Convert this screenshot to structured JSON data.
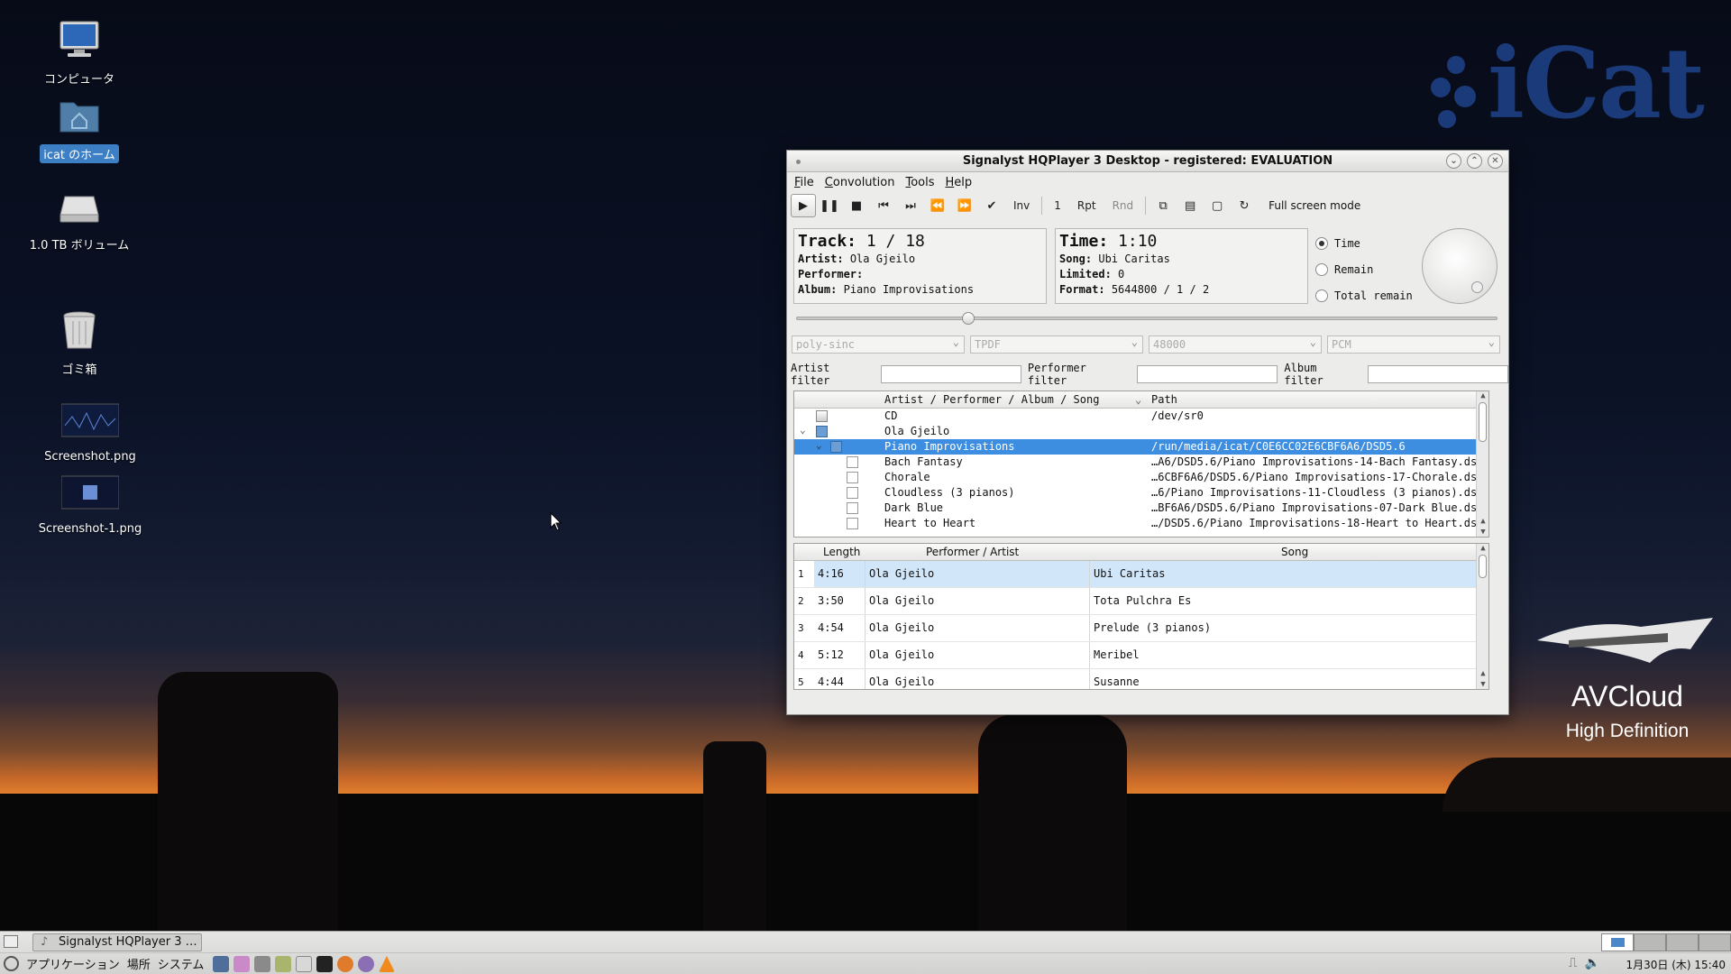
{
  "desktop": {
    "icons": [
      {
        "label": "コンピュータ",
        "icon": "computer-icon"
      },
      {
        "label": "icat のホーム",
        "icon": "home-folder-icon"
      },
      {
        "label": "1.0 TB ボリューム",
        "icon": "drive-icon"
      },
      {
        "label": "ゴミ箱",
        "icon": "trash-icon"
      },
      {
        "label": "Screenshot.png",
        "icon": "image-file-icon"
      },
      {
        "label": "Screenshot-1.png",
        "icon": "image-file-icon"
      }
    ],
    "wallpaper_logo": "iCat",
    "watermark_title": "AVCloud",
    "watermark_subtitle": "High Definition"
  },
  "window": {
    "title": "Signalyst HQPlayer 3 Desktop - registered: EVALUATION",
    "menu": [
      "File",
      "Convolution",
      "Tools",
      "Help"
    ],
    "toolbar": {
      "inv": "Inv",
      "count": "1",
      "rpt": "Rpt",
      "rnd": "Rnd",
      "fullscreen": "Full screen mode"
    },
    "track_info": {
      "track_label": "Track:",
      "track_value": "1 / 18",
      "artist_label": "Artist:",
      "artist_value": "Ola Gjeilo",
      "performer_label": "Performer:",
      "performer_value": "",
      "album_label": "Album:",
      "album_value": "Piano Improvisations"
    },
    "time_info": {
      "time_label": "Time:",
      "time_value": "1:10",
      "song_label": "Song:",
      "song_value": "Ubi Caritas",
      "limited_label": "Limited:",
      "limited_value": "0",
      "format_label": "Format:",
      "format_value": "5644800 / 1 / 2"
    },
    "time_mode": {
      "options": [
        "Time",
        "Remain",
        "Total remain"
      ],
      "selected": "Time"
    },
    "seek_fraction": 0.24,
    "combos": {
      "filter": "poly-sinc",
      "dither": "TPDF",
      "rate": "48000",
      "mode": "PCM"
    },
    "filters": {
      "artist_label": "Artist filter",
      "artist_value": "",
      "performer_label": "Performer filter",
      "performer_value": "",
      "album_label": "Album filter",
      "album_value": ""
    },
    "library": {
      "col_name": "Artist / Performer / Album / Song",
      "col_path": "Path",
      "rows": [
        {
          "name": "CD",
          "path": "/dev/sr0"
        },
        {
          "name": "Ola Gjeilo",
          "path": ""
        },
        {
          "name": "Piano Improvisations",
          "path": "/run/media/icat/C0E6CC02E6CBF6A6/DSD5.6"
        },
        {
          "name": "Bach Fantasy",
          "path": "…A6/DSD5.6/Piano Improvisations-14-Bach Fantasy.dsf"
        },
        {
          "name": "Chorale",
          "path": "…6CBF6A6/DSD5.6/Piano Improvisations-17-Chorale.dsf"
        },
        {
          "name": "Cloudless (3 pianos)",
          "path": "…6/Piano Improvisations-11-Cloudless (3 pianos).dsf"
        },
        {
          "name": "Dark Blue",
          "path": "…BF6A6/DSD5.6/Piano Improvisations-07-Dark Blue.dsf"
        },
        {
          "name": "Heart to Heart",
          "path": "…/DSD5.6/Piano Improvisations-18-Heart to Heart.dsf"
        }
      ]
    },
    "playlist": {
      "col_length": "Length",
      "col_performer": "Performer / Artist",
      "col_song": "Song",
      "rows": [
        {
          "num": "1",
          "length": "4:16",
          "performer": "Ola Gjeilo",
          "song": "Ubi Caritas"
        },
        {
          "num": "2",
          "length": "3:50",
          "performer": "Ola Gjeilo",
          "song": "Tota Pulchra Es"
        },
        {
          "num": "3",
          "length": "4:54",
          "performer": "Ola Gjeilo",
          "song": "Prelude (3 pianos)"
        },
        {
          "num": "4",
          "length": "5:12",
          "performer": "Ola Gjeilo",
          "song": "Meribel"
        },
        {
          "num": "5",
          "length": "4:44",
          "performer": "Ola Gjeilo",
          "song": "Susanne"
        }
      ]
    }
  },
  "taskbar": {
    "task_label": "Signalyst HQPlayer 3 …",
    "menus": [
      "アプリケーション",
      "場所",
      "システム"
    ],
    "clock": "1月30日 (木) 15:40",
    "colors": {
      "accent": "#3d8ee0"
    }
  }
}
